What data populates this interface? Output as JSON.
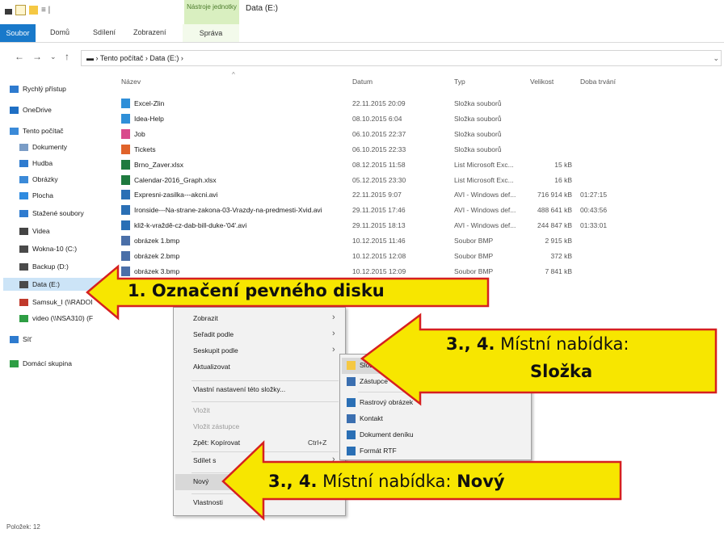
{
  "window": {
    "title": "Data (E:)",
    "context_tab": "Nástroje jednotky",
    "quick_access_caret": "≡ |"
  },
  "ribbon": {
    "tabs": [
      "Soubor",
      "Domů",
      "Sdílení",
      "Zobrazení",
      "Správa"
    ]
  },
  "address": {
    "back": "←",
    "forward": "→",
    "recent": "⌄",
    "up": "↑",
    "path": "▬ › Tento počítač › Data (E:) ›",
    "dropdown": "⌄"
  },
  "nav": [
    {
      "label": "Rychlý přístup",
      "icon": "star-icon",
      "color": "#2e7bcf"
    },
    {
      "label": "OneDrive",
      "icon": "cloud-icon",
      "color": "#1f6fc4"
    },
    {
      "label": "Tento počítač",
      "icon": "computer-icon",
      "color": "#3b8ad8"
    },
    {
      "label": "Dokumenty",
      "icon": "document-icon",
      "color": "#7a9cc6"
    },
    {
      "label": "Hudba",
      "icon": "music-icon",
      "color": "#2e7bcf"
    },
    {
      "label": "Obrázky",
      "icon": "pictures-icon",
      "color": "#3b8ad8"
    },
    {
      "label": "Plocha",
      "icon": "desktop-icon",
      "color": "#2e8be0"
    },
    {
      "label": "Stažené soubory",
      "icon": "download-icon",
      "color": "#2e7bcf"
    },
    {
      "label": "Videa",
      "icon": "video-icon",
      "color": "#444444"
    },
    {
      "label": "Wokna-10 (C:)",
      "icon": "drive-icon",
      "color": "#4a4a4a"
    },
    {
      "label": "Backup (D:)",
      "icon": "drive-icon",
      "color": "#4a4a4a"
    },
    {
      "label": "Data (E:)",
      "icon": "drive-icon",
      "color": "#4a4a4a"
    },
    {
      "label": "Samsuk_I (\\\\RADOI",
      "icon": "network-drive-icon",
      "color": "#c0392b"
    },
    {
      "label": "video (\\\\NSA310) (F",
      "icon": "network-drive-icon",
      "color": "#2e9e44"
    },
    {
      "label": "Síť",
      "icon": "network-icon",
      "color": "#2e7bcf"
    },
    {
      "label": "Domácí skupina",
      "icon": "homegroup-icon",
      "color": "#2e9e44"
    }
  ],
  "columns": {
    "name": "Název",
    "date": "Datum",
    "type": "Typ",
    "size": "Velikost",
    "duration": "Doba trvání",
    "sort_indicator": "^"
  },
  "files": [
    {
      "name": "Excel-Zlin",
      "date": "22.11.2015 20:09",
      "type": "Složka souborů",
      "size": "",
      "duration": "",
      "icon_color": "#2f8fd8"
    },
    {
      "name": "Idea-Help",
      "date": "08.10.2015 6:04",
      "type": "Složka souborů",
      "size": "",
      "duration": "",
      "icon_color": "#2f8fd8"
    },
    {
      "name": "Job",
      "date": "06.10.2015 22:37",
      "type": "Složka souborů",
      "size": "",
      "duration": "",
      "icon_color": "#d94a8c"
    },
    {
      "name": "Tickets",
      "date": "06.10.2015 22:33",
      "type": "Složka souborů",
      "size": "",
      "duration": "",
      "icon_color": "#e0632a"
    },
    {
      "name": "Brno_Zaver.xlsx",
      "date": "08.12.2015 11:58",
      "type": "List Microsoft Exc...",
      "size": "15 kB",
      "duration": "",
      "icon_color": "#1f7a3f"
    },
    {
      "name": "Calendar-2016_Graph.xlsx",
      "date": "05.12.2015 23:30",
      "type": "List Microsoft Exc...",
      "size": "16 kB",
      "duration": "",
      "icon_color": "#1f7a3f"
    },
    {
      "name": "Expresni-zasilka---akcni.avi",
      "date": "22.11.2015 9:07",
      "type": "AVI - Windows def...",
      "size": "716 914 kB",
      "duration": "01:27:15",
      "icon_color": "#2a6fb5"
    },
    {
      "name": "Ironside---Na-strane-zakona-03-Vrazdy-na-predmesti-Xvid.avi",
      "date": "29.11.2015 17:46",
      "type": "AVI - Windows def...",
      "size": "488 641 kB",
      "duration": "00:43:56",
      "icon_color": "#2a6fb5"
    },
    {
      "name": "kliž-k-vraždě-cz-dab-bill-duke-'04'.avi",
      "date": "29.11.2015 18:13",
      "type": "AVI - Windows def...",
      "size": "244 847 kB",
      "duration": "01:33:01",
      "icon_color": "#2a6fb5"
    },
    {
      "name": "obrázek 1.bmp",
      "date": "10.12.2015 11:46",
      "type": "Soubor BMP",
      "size": "2 915 kB",
      "duration": "",
      "icon_color": "#4a6fa8"
    },
    {
      "name": "obrázek 2.bmp",
      "date": "10.12.2015 12:08",
      "type": "Soubor BMP",
      "size": "372 kB",
      "duration": "",
      "icon_color": "#4a6fa8"
    },
    {
      "name": "obrázek 3.bmp",
      "date": "10.12.2015 12:09",
      "type": "Soubor BMP",
      "size": "7 841 kB",
      "duration": "",
      "icon_color": "#4a6fa8"
    }
  ],
  "context_menu": {
    "items": [
      {
        "label": "Zobrazit",
        "submenu": true,
        "disabled": false
      },
      {
        "label": "Seřadit podle",
        "submenu": true,
        "disabled": false
      },
      {
        "label": "Seskupit podle",
        "submenu": true,
        "disabled": false
      },
      {
        "label": "Aktualizovat",
        "submenu": false,
        "disabled": false
      },
      {
        "label": "Vlastní nastavení této složky...",
        "submenu": false,
        "disabled": false
      },
      {
        "label": "Vložit",
        "submenu": false,
        "disabled": true
      },
      {
        "label": "Vložit zástupce",
        "submenu": false,
        "disabled": true
      },
      {
        "label": "Zpět: Kopírovat",
        "submenu": false,
        "disabled": false,
        "shortcut": "Ctrl+Z"
      },
      {
        "label": "Sdílet s",
        "submenu": true,
        "disabled": false
      },
      {
        "label": "Nový",
        "submenu": true,
        "disabled": false,
        "highlighted": true
      },
      {
        "label": "Vlastnosti",
        "submenu": false,
        "disabled": false
      }
    ]
  },
  "submenu_new": {
    "items": [
      {
        "label": "Složka",
        "icon": "folder-icon",
        "color": "#f5c843",
        "highlighted": true
      },
      {
        "label": "Zástupce",
        "icon": "shortcut-icon",
        "color": "#3b6fb0"
      },
      {
        "label": "Rastrový obrázek",
        "icon": "bitmap-icon",
        "color": "#2a6fb5"
      },
      {
        "label": "Kontakt",
        "icon": "contact-icon",
        "color": "#3b6fb0"
      },
      {
        "label": "Dokument deníku",
        "icon": "journal-icon",
        "color": "#2a6fb5"
      },
      {
        "label": "Formát RTF",
        "icon": "rtf-icon",
        "color": "#2a6fb5"
      }
    ]
  },
  "callouts": {
    "step1": "1. Označení pevného disku",
    "step34_folder_line1_bold": "3., 4.",
    "step34_folder_line1_rest": " Místní nabídka:",
    "step34_folder_line2": "Složka",
    "step34_new_bold1": "3., 4.",
    "step34_new_mid": " Místní nabídka: ",
    "step34_new_bold2": "Nový"
  },
  "colors": {
    "accent": "#1979ca",
    "callout_fill": "#f7e600",
    "callout_border": "#d62020",
    "selection": "#cce4f7"
  },
  "status": "Položek: 12"
}
